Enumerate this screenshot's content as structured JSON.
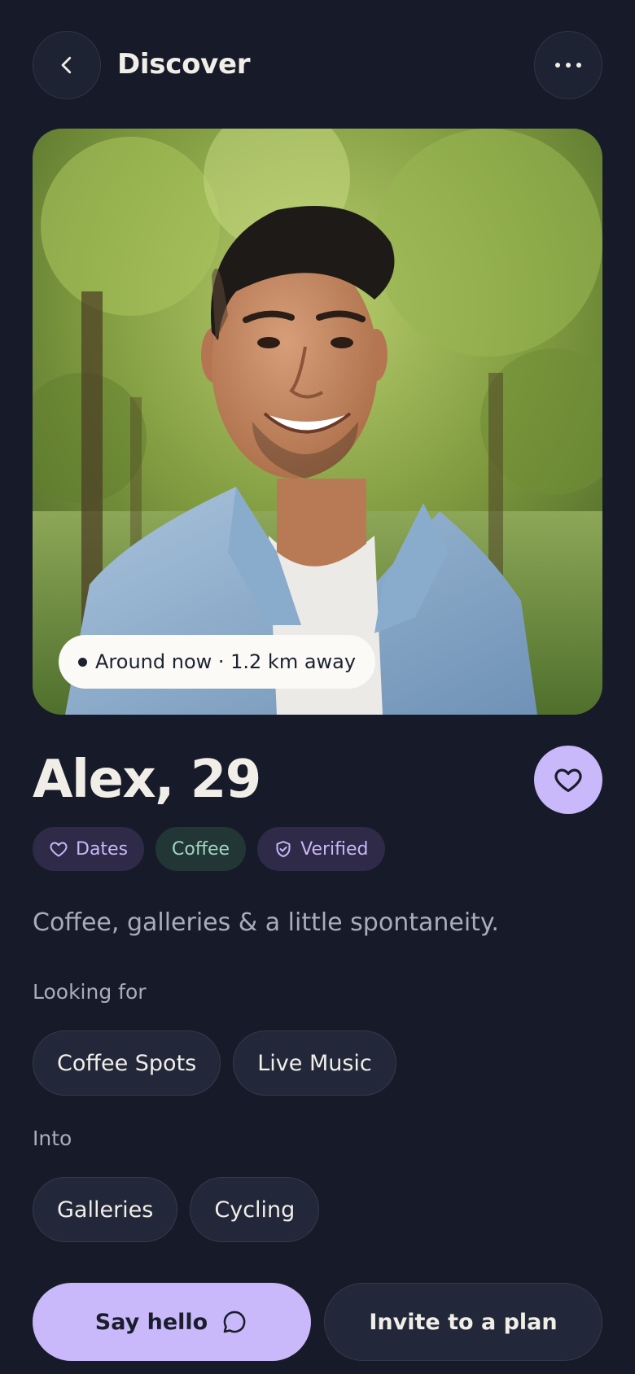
{
  "header": {
    "title": "Discover",
    "back_icon": "chevron-left-icon",
    "more_icon": "more-horizontal-icon"
  },
  "profile": {
    "photo_alt": "Profile photo",
    "presence": "Around now · 1.2 km away",
    "name_age": "Alex, 29",
    "tags": [
      {
        "label": "Dates",
        "icon": "heart-icon",
        "color": "#c8b7f8"
      },
      {
        "label": "Coffee",
        "icon": "",
        "color": "#9fd7c0"
      },
      {
        "label": "Verified",
        "icon": "shield-check-icon",
        "color": "#c8b7f8"
      }
    ],
    "bio": "Coffee, galleries & a little spontaneity.",
    "looking_for": {
      "label": "Looking for",
      "items": [
        "Coffee Spots",
        "Live Music"
      ]
    },
    "into": {
      "label": "Into",
      "items": [
        "Galleries",
        "Cycling"
      ]
    }
  },
  "actions": {
    "say_hello": "Say hello",
    "invite": "Invite to a plan"
  },
  "colors": {
    "background": "#171b29",
    "accent": "#c9b8fa",
    "surface": "#222839"
  }
}
